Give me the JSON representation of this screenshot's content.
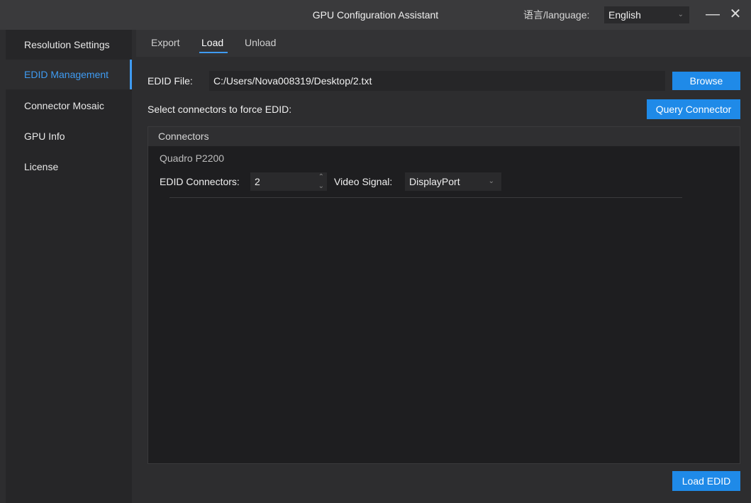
{
  "window": {
    "title": "GPU Configuration Assistant",
    "language_label": "语言/language:",
    "language_value": "English",
    "minimize_glyph": "—",
    "close_glyph": "✕"
  },
  "sidebar": {
    "items": [
      {
        "label": "Resolution Settings",
        "active": false
      },
      {
        "label": "EDID Management",
        "active": true
      },
      {
        "label": "Connector Mosaic",
        "active": false
      },
      {
        "label": "GPU Info",
        "active": false
      },
      {
        "label": "License",
        "active": false
      }
    ]
  },
  "tabs": [
    {
      "label": "Export",
      "active": false
    },
    {
      "label": "Load",
      "active": true
    },
    {
      "label": "Unload",
      "active": false
    }
  ],
  "load": {
    "edid_file_label": "EDID File:",
    "edid_file_value": "C:/Users/Nova008319/Desktop/2.txt",
    "browse_label": "Browse",
    "select_connectors_label": "Select connectors to force EDID:",
    "query_connector_label": "Query Connector",
    "connectors_panel_title": "Connectors",
    "gpu_name": "Quadro P2200",
    "edid_connectors_label": "EDID Connectors:",
    "edid_connectors_value": "2",
    "video_signal_label": "Video Signal:",
    "video_signal_value": "DisplayPort",
    "load_edid_label": "Load EDID"
  },
  "colors": {
    "accent": "#3f9bf2",
    "button": "#1f8ae8",
    "background": "#2d2d2f",
    "panel": "#1e1e20"
  }
}
